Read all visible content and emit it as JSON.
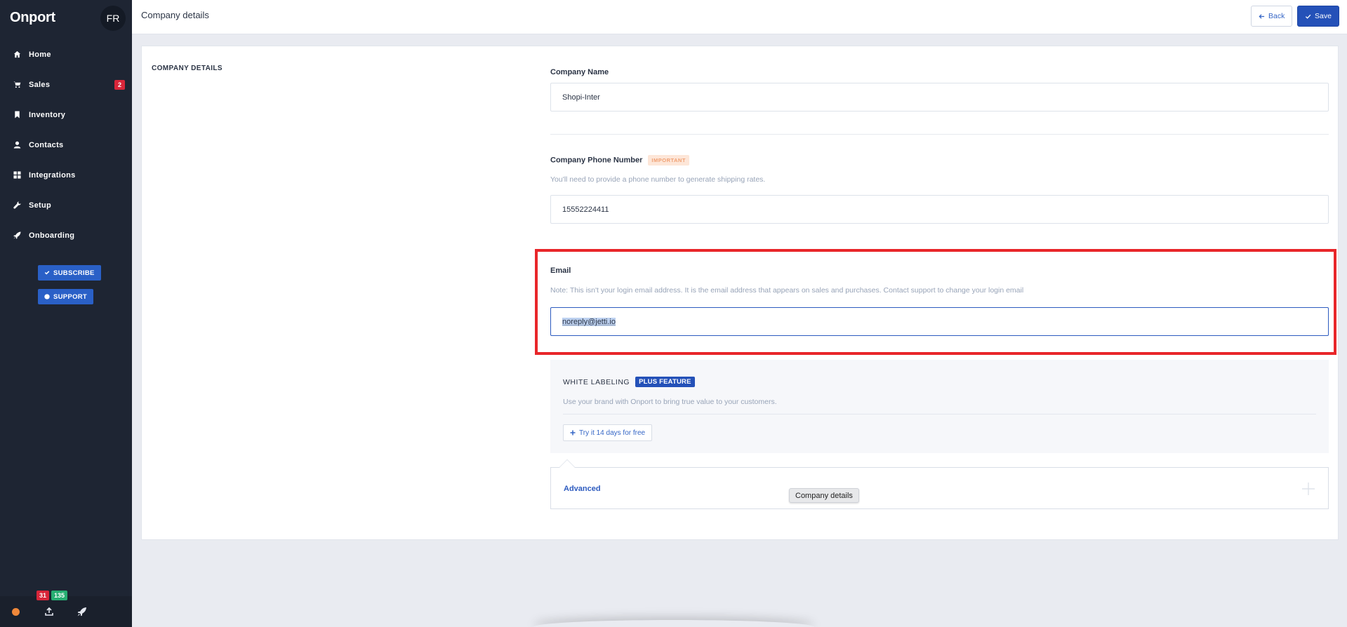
{
  "sidebar": {
    "brand": "Onport",
    "avatar_initials": "FR",
    "items": [
      {
        "label": "Home",
        "icon": "home-icon"
      },
      {
        "label": "Sales",
        "icon": "cart-icon",
        "badge": "2"
      },
      {
        "label": "Inventory",
        "icon": "bookmark-icon"
      },
      {
        "label": "Contacts",
        "icon": "user-icon"
      },
      {
        "label": "Integrations",
        "icon": "grid-icon"
      },
      {
        "label": "Setup",
        "icon": "wrench-icon"
      },
      {
        "label": "Onboarding",
        "icon": "rocket-icon"
      }
    ],
    "subscribe_label": "SUBSCRIBE",
    "support_label": "SUPPORT",
    "footer": {
      "upload_count": "31",
      "done_count": "135",
      "status_color": "#f0883a"
    }
  },
  "header": {
    "title": "Company details",
    "back_label": "Back",
    "save_label": "Save"
  },
  "form": {
    "section_title": "COMPANY DETAILS",
    "company_name": {
      "label": "Company Name",
      "value": "Shopi-Inter"
    },
    "phone": {
      "label": "Company Phone Number",
      "tag": "IMPORTANT",
      "help": "You'll need to provide a phone number to generate shipping rates.",
      "value": "15552224411"
    },
    "email": {
      "label": "Email",
      "help": "Note: This isn't your login email address. It is the email address that appears on sales and purchases. Contact support to change your login email",
      "value": "noreply@jetti.io"
    },
    "white_labeling": {
      "title": "WHITE LABELING",
      "tag": "PLUS FEATURE",
      "description": "Use your brand with Onport to bring true value to your customers.",
      "try_label": "Try it 14 days for free"
    },
    "advanced": {
      "label": "Advanced"
    }
  },
  "tooltip": "Company details",
  "colors": {
    "sidebar_bg": "#1e2533",
    "accent": "#2451b8",
    "highlight_border": "#e8262a",
    "badge_red": "#d8263a",
    "badge_green": "#27ae72"
  }
}
